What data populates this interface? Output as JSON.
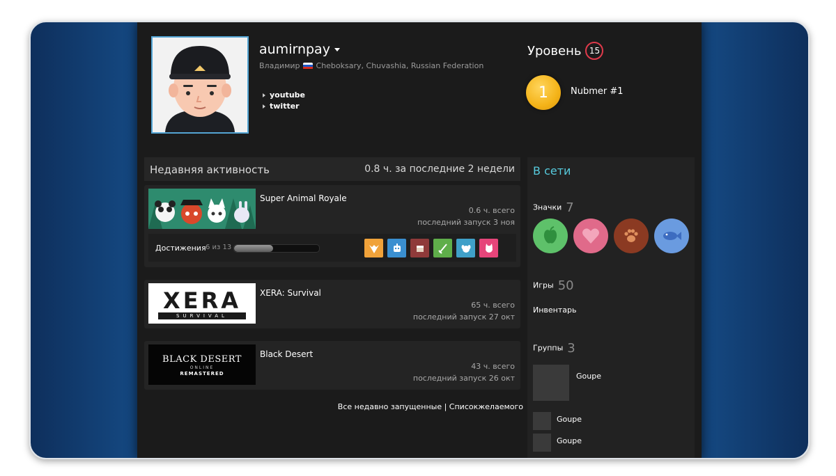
{
  "profile": {
    "username": "aumirnpay",
    "real_name": "Владимир",
    "location": "Cheboksary, Chuvashia, Russian Federation",
    "links": [
      "youtube",
      "twitter"
    ]
  },
  "level": {
    "label": "Уровень",
    "value": "15"
  },
  "featured_badge": {
    "number": "1",
    "label": "Nubmer #1",
    "color": "#f4b318"
  },
  "activity": {
    "title": "Недавняя активность",
    "hours": "0.8 ч. за последние 2 недели",
    "games": [
      {
        "name": "Super Animal Royale",
        "hours": "0.6 ч. всего",
        "last_played": "последний запуск 3 ноя"
      },
      {
        "name": "XERA: Survival",
        "logo_text": "XERA",
        "logo_sub": "SURVIVAL",
        "hours": "65 ч. всего",
        "last_played": "последний запуск 27 окт"
      },
      {
        "name": "Black Desert",
        "logo_text": "BLACK DESERT",
        "logo_sub1": "ONLINE",
        "logo_sub2": "REMASTERED",
        "hours": "43 ч. всего",
        "last_played": "последний запуск 26 окт"
      }
    ],
    "achievements": {
      "label": "Достижения",
      "count": "6 из 13",
      "progress": 0.46
    },
    "footer_links": "Все недавно запущенные | Списокжелаемого"
  },
  "sidebar": {
    "status": "В сети",
    "badges_label": "Значки",
    "badges_count": "7",
    "badge_icons": [
      "apple-icon",
      "heart-icon",
      "paw-icon",
      "fish-icon"
    ],
    "games_label": "Игры",
    "games_count": "50",
    "inventory_label": "Инвентарь",
    "groups_label": "Группы",
    "groups_count": "3",
    "groups": [
      "Goupe",
      "Goupe",
      "Goupe"
    ]
  },
  "colors": {
    "accent": "#57cbde",
    "level_ring": "#e03a4b",
    "panel": "#1b1b1b"
  }
}
